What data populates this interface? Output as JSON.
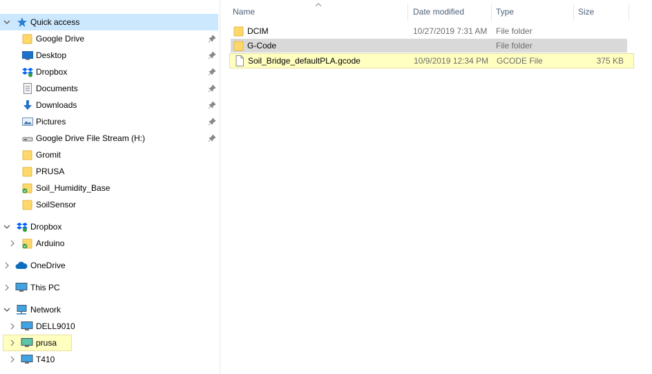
{
  "nav": {
    "quick_access": "Quick access",
    "quick_items": [
      {
        "label": "Google Drive"
      },
      {
        "label": "Desktop"
      },
      {
        "label": "Dropbox"
      },
      {
        "label": "Documents"
      },
      {
        "label": "Downloads"
      },
      {
        "label": "Pictures"
      },
      {
        "label": "Google Drive File Stream (H:)"
      },
      {
        "label": "Gromit"
      },
      {
        "label": "PRUSA"
      },
      {
        "label": "Soil_Humidity_Base"
      },
      {
        "label": "SoilSensor"
      }
    ],
    "dropbox": "Dropbox",
    "dropbox_children": [
      {
        "label": "Arduino"
      }
    ],
    "onedrive": "OneDrive",
    "thispc": "This PC",
    "network": "Network",
    "network_children": [
      {
        "label": "DELL9010"
      },
      {
        "label": "prusa"
      },
      {
        "label": "T410"
      }
    ]
  },
  "list": {
    "columns": {
      "name": "Name",
      "date": "Date modified",
      "type": "Type",
      "size": "Size"
    },
    "rows": [
      {
        "name": "DCIM",
        "date": "10/27/2019 7:31 AM",
        "type": "File folder",
        "size": ""
      },
      {
        "name": "G-Code",
        "date": "",
        "type": "File folder",
        "size": ""
      },
      {
        "name": "Soil_Bridge_defaultPLA.gcode",
        "date": "10/9/2019 12:34 PM",
        "type": "GCODE File",
        "size": "375 KB"
      }
    ]
  },
  "colors": {
    "selected_nav": "#cce8ff",
    "highlight": "#ffffc0",
    "selected_row": "#d9d9d9",
    "header_text": "#4c607a",
    "folder": "#ffd86b"
  }
}
